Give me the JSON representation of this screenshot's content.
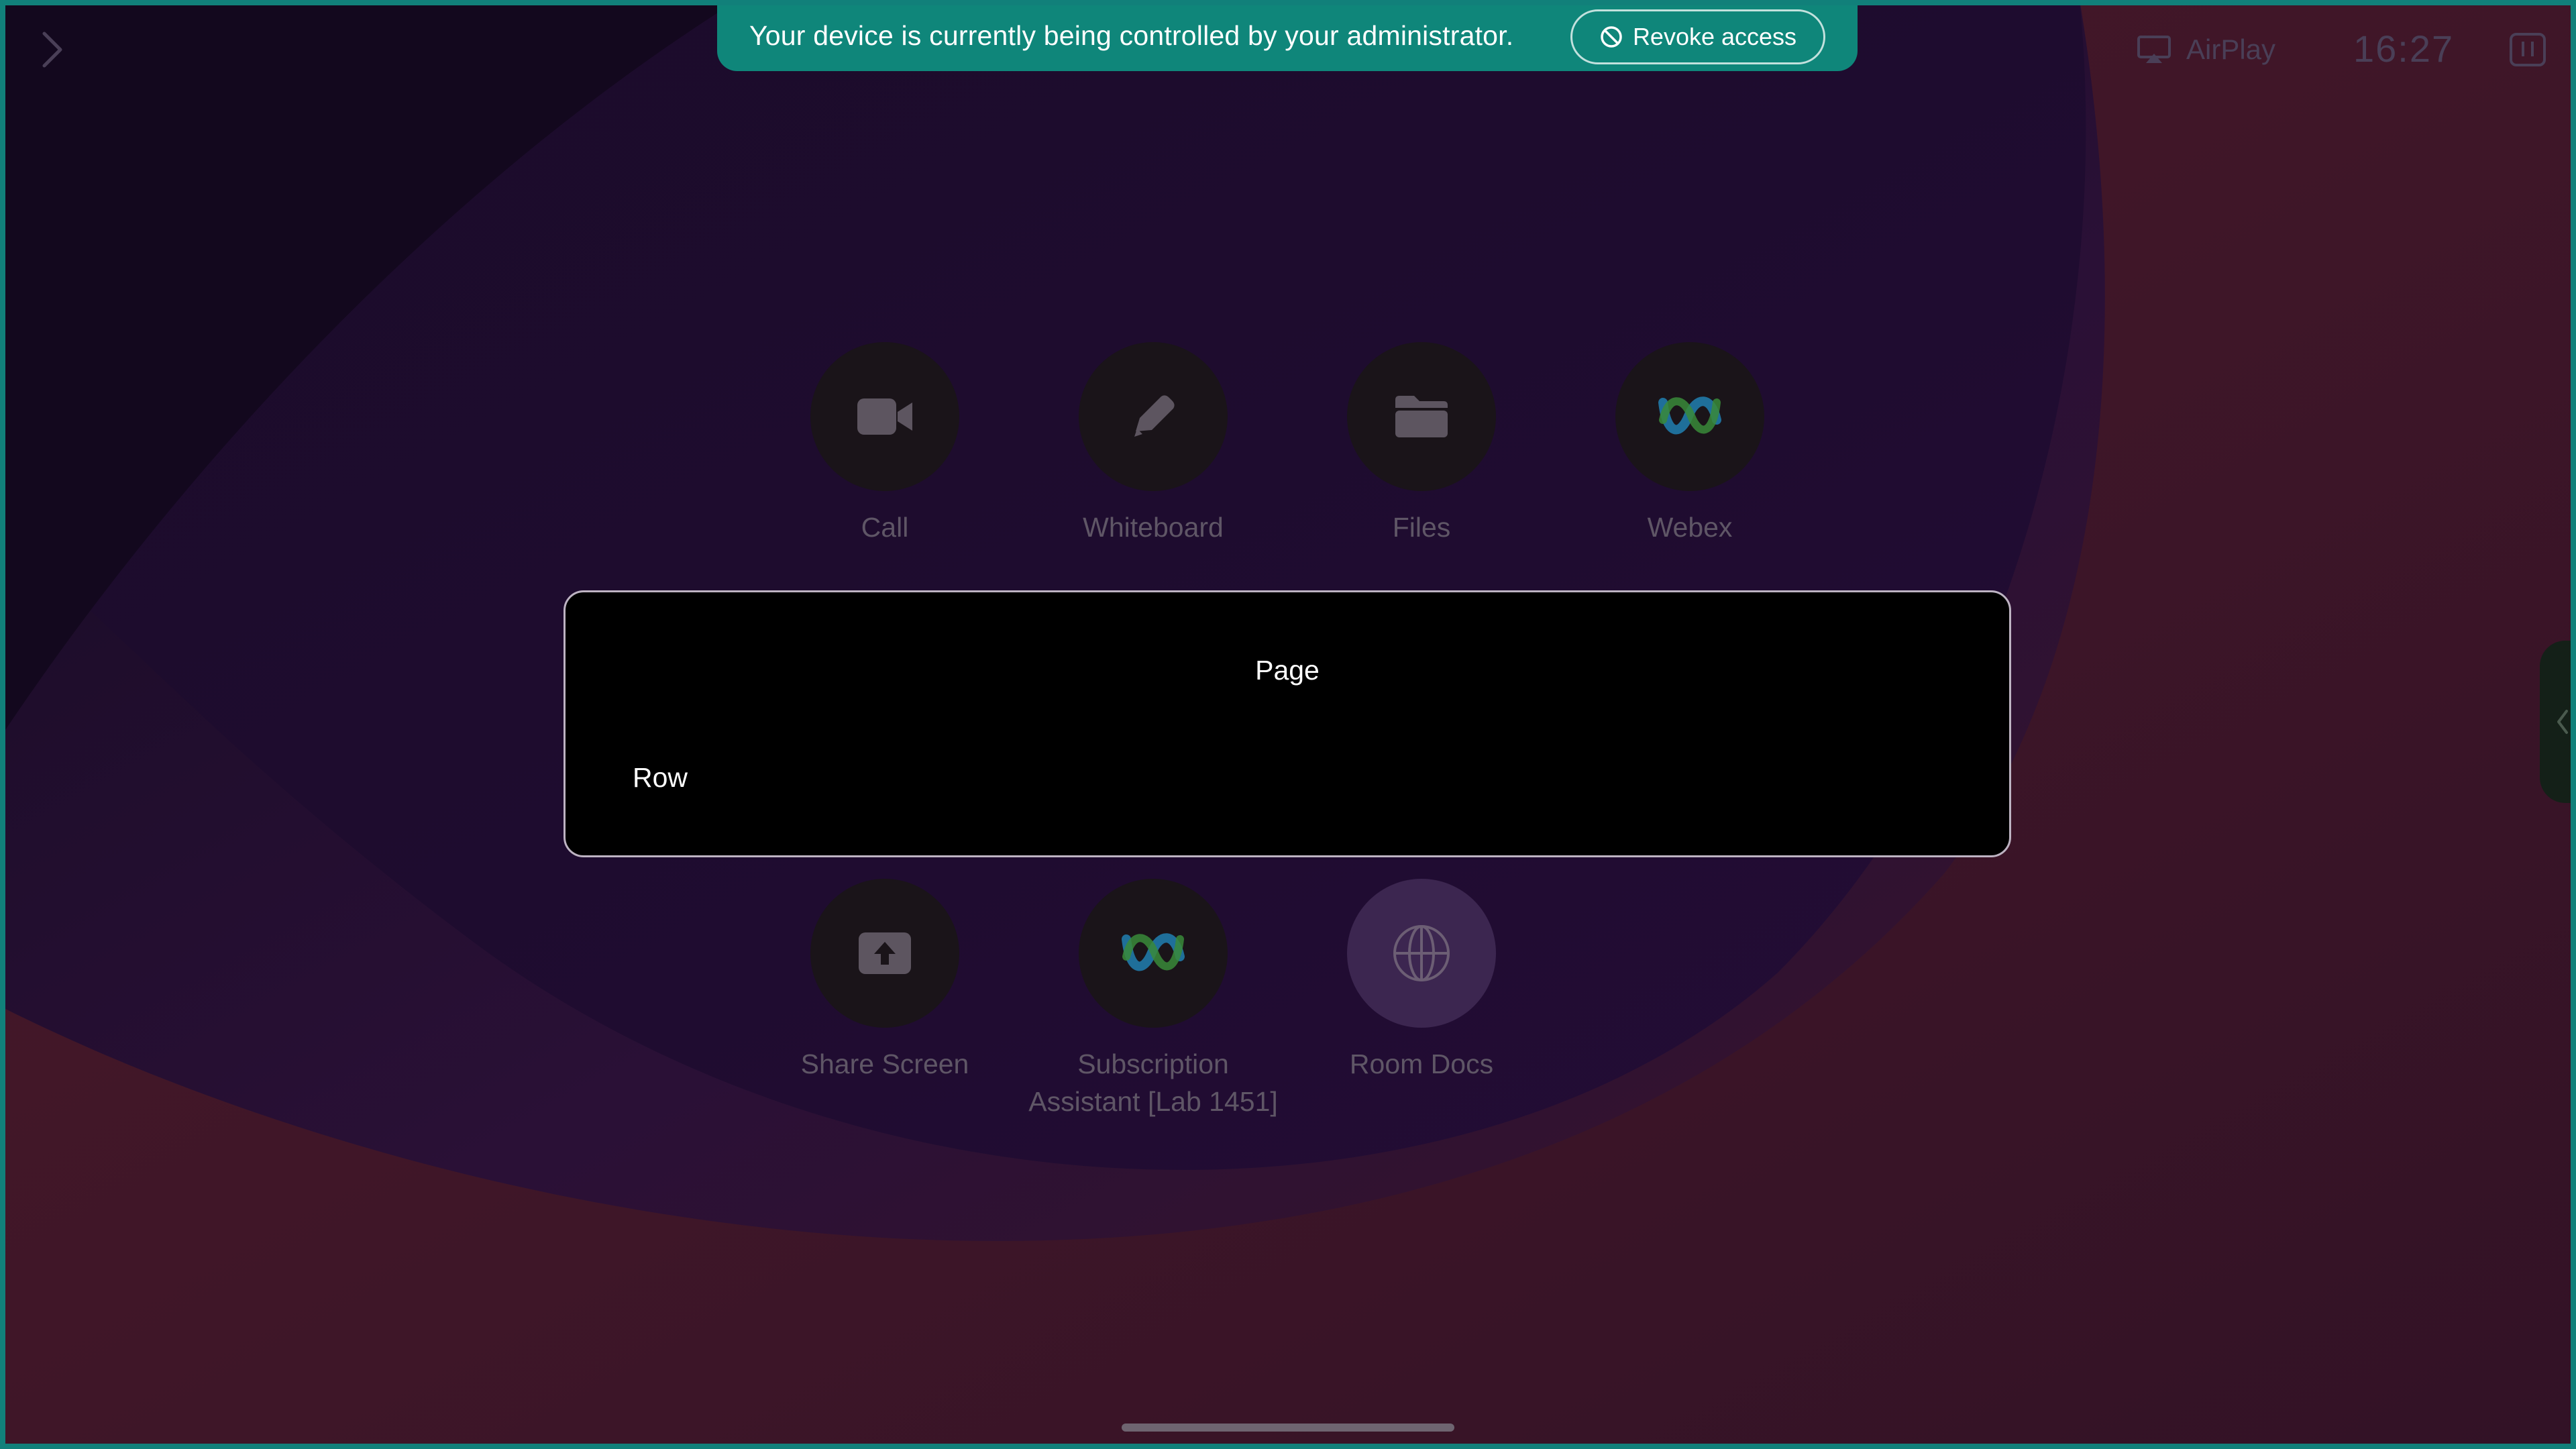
{
  "banner": {
    "message": "Your device is currently being controlled by your administrator.",
    "revoke_label": "Revoke access"
  },
  "topbar": {
    "airplay_label": "AirPlay",
    "time": "16:27"
  },
  "apps_row1": [
    {
      "label": "Call",
      "icon": "video-camera-icon"
    },
    {
      "label": "Whiteboard",
      "icon": "pencil-icon"
    },
    {
      "label": "Files",
      "icon": "folder-icon"
    },
    {
      "label": "Webex",
      "icon": "webex-logo-icon"
    }
  ],
  "apps_row2": [
    {
      "label": "Share Screen",
      "icon": "share-screen-icon"
    },
    {
      "label": "Subscription Assistant [Lab 1451]",
      "icon": "webex-logo-icon"
    },
    {
      "label": "Room Docs",
      "icon": "globe-icon"
    }
  ],
  "overlay": {
    "title": "Page",
    "row_label": "Row"
  },
  "colors": {
    "banner": "#0f867a",
    "frame": "#11807a",
    "panel_bg": "#000000",
    "app_label": "#5f5666"
  }
}
